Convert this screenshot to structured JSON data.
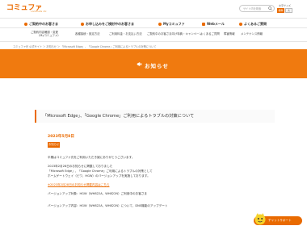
{
  "header": {
    "logo_text": "コミュファ",
    "logo_sub": "commufa ctc",
    "search_placeholder": "サイト内を検索",
    "font_size_label": "文字サイズ",
    "font_sizes": [
      "標準",
      "大"
    ]
  },
  "nav_primary": [
    "ご契約中のお客さま",
    "お申し込みをご検討中のお客さま",
    "Myコミュファ",
    "Webメール",
    "よくあるご質問"
  ],
  "nav_secondary": [
    {
      "line1": "ご契約内容確認・変更",
      "line2": "（Myコミュファ）"
    },
    {
      "line1": "各種接続・設定方法"
    },
    {
      "line1": "ご利用料金・お支払い方法"
    },
    {
      "line1": "ご契約中のお客さま向け特典・キャンペーン"
    },
    {
      "line1": "よくあるご質問"
    },
    {
      "line1": "障害情報"
    },
    {
      "line1": "メンテナンス情報"
    }
  ],
  "breadcrumb": "コミュファ光 公式サイト ＞ お知らせ ＞ 「Microsoft Edge」、「Google Chrome」ご利用によるトラブルの対策について",
  "banner": {
    "title": "お知らせ"
  },
  "article": {
    "title": "「Microsoft Edge」、「Google Chrome」ご利用によるトラブルの対策について",
    "date": "2023年5月8日",
    "tag": "お知らせ",
    "paragraphs": [
      "平素はコミュファ光をご利用いただき誠にありがとうございます。",
      "2023年2月28日のお知らせに掲載しておりました",
      "「Microsoft Edge」、「Google Chrome」ご利用によるトラブルの対策として",
      "ホームゲートウェイ（ビワ、HGW）のバージョンアップを実施しております。",
      "※2023年2月28日のお知らせ掲載内容はこちら",
      "バージョンアップ対象：HGW（WH822A、WH822N）ご利用中のお客さま",
      "バージョンアップ内容：HGW（WH822A、WH822N）について、DNS機能のアップデート"
    ]
  },
  "chat": {
    "label": "チャットサポート"
  },
  "colors": {
    "accent": "#ea6a00",
    "banner": "#f07a0f"
  }
}
